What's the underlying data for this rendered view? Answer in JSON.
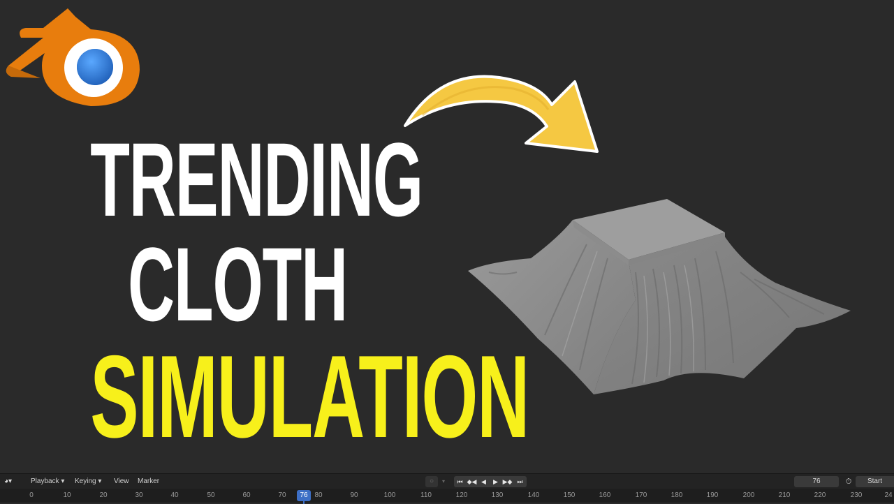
{
  "headline": {
    "line1": "TRENDING",
    "line2": "CLOTH",
    "line3": "SIMULATION",
    "colors": {
      "line1": "#ffffff",
      "line2": "#ffffff",
      "line3": "#f7f01b"
    }
  },
  "logo": {
    "icon": "blender-logo-icon"
  },
  "arrow": {
    "icon": "curved-arrow-icon",
    "color": "#f5c842"
  },
  "render": {
    "icon": "cloth-draped-table-render"
  },
  "timeline": {
    "editor_icon": "clock-editor-icon",
    "menu": [
      "Playback",
      "Keying",
      "View",
      "Marker"
    ],
    "current_frame": "76",
    "start_label": "Start",
    "ticks": [
      "0",
      "10",
      "20",
      "30",
      "40",
      "50",
      "60",
      "70",
      "80",
      "90",
      "100",
      "110",
      "120",
      "130",
      "140",
      "150",
      "160",
      "170",
      "180",
      "190",
      "200",
      "210",
      "220",
      "230",
      "24"
    ]
  }
}
